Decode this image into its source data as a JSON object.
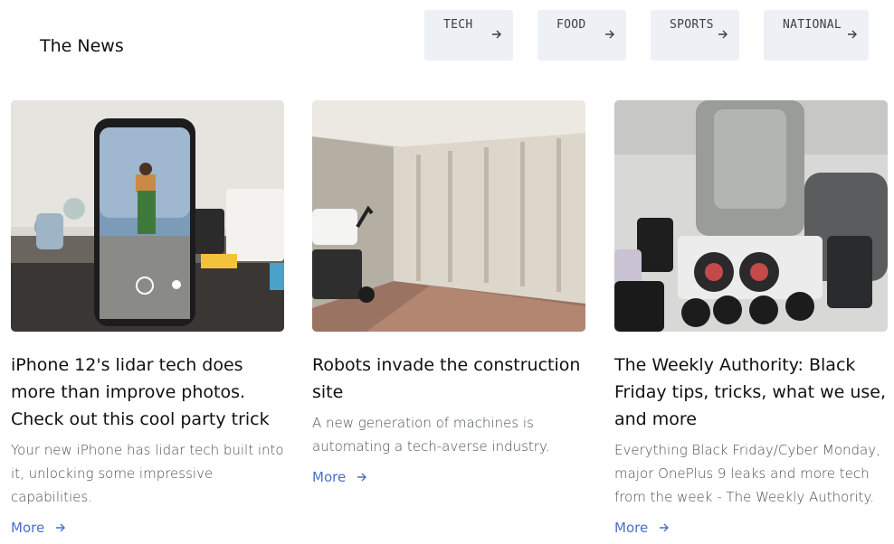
{
  "header": {
    "brand": "The News",
    "categories": [
      "TECH",
      "FOOD",
      "SPORTS",
      "NATIONAL"
    ]
  },
  "articles": [
    {
      "title": "iPhone 12's lidar tech does more than improve photos. Check out this cool party trick",
      "description": "Your new iPhone has lidar tech built into it, unlocking some impressive capabilities.",
      "more_label": "More"
    },
    {
      "title": "Robots invade the construction site",
      "description": "A new generation of machines is automating a tech-averse industry.",
      "more_label": "More"
    },
    {
      "title": "The Weekly Authority: Black Friday tips, tricks, what we use, and more",
      "description": "Everything Black Friday/Cyber Monday, major OnePlus 9 leaks and more tech from the week - The Weekly Authority.",
      "more_label": "More"
    }
  ],
  "colors": {
    "category_bg": "#edf1f6",
    "link": "#4b6fc9",
    "text": "#111111",
    "muted": "#4a4f58"
  }
}
